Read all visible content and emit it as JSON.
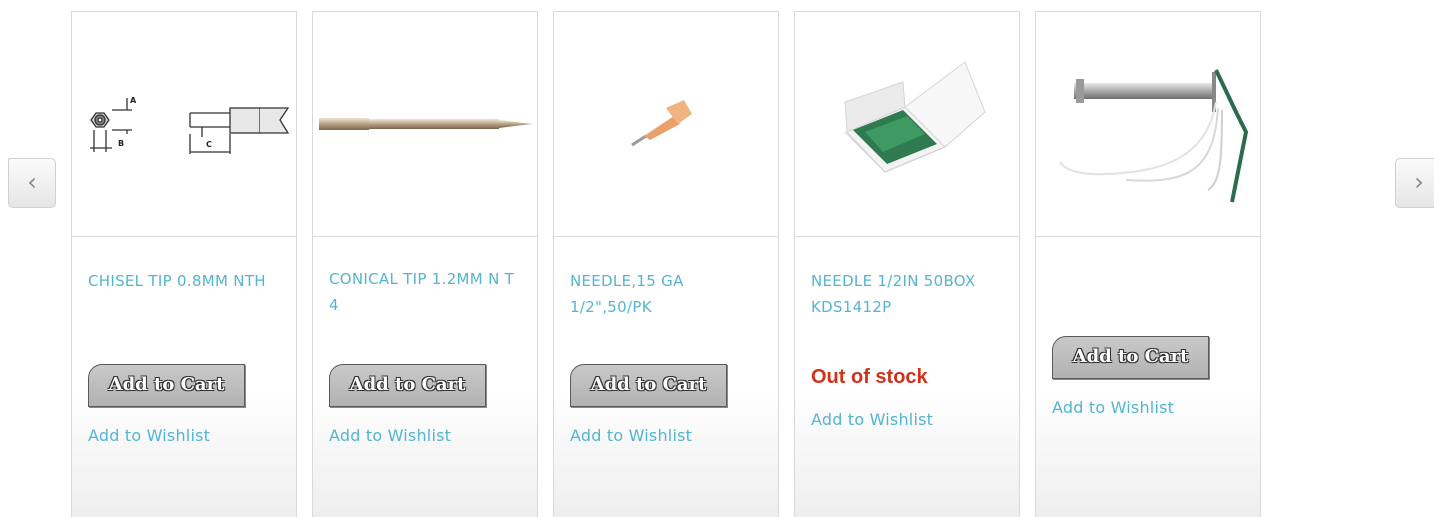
{
  "carousel": {
    "prev_icon": "chevron-left-icon",
    "next_icon": "chevron-right-icon",
    "prev_glyph": "‹",
    "next_glyph": "›"
  },
  "products": [
    {
      "name": "CHISEL TIP 0.8MM NTH",
      "cart_label": "Add to Cart",
      "wishlist_label": "Add to Wishlist"
    },
    {
      "name": "CONICAL TIP 1.2MM N T 4",
      "cart_label": "Add to Cart",
      "wishlist_label": "Add to Wishlist"
    },
    {
      "name": "NEEDLE,15 GA 1/2\",50/PK",
      "cart_label": "Add to Cart",
      "wishlist_label": "Add to Wishlist"
    },
    {
      "name": "NEEDLE 1/2IN 50BOX KDS1412P",
      "stock_status": "Out of stock",
      "wishlist_label": "Add to Wishlist"
    },
    {
      "name": "",
      "cart_label": "Add to Cart",
      "wishlist_label": "Add to Wishlist"
    }
  ],
  "diagram_labels": {
    "a": "A",
    "b": "B",
    "c": "C"
  },
  "colors": {
    "link": "#53b5d1",
    "out_of_stock": "#d2301b",
    "button": "#bcbcbc"
  }
}
